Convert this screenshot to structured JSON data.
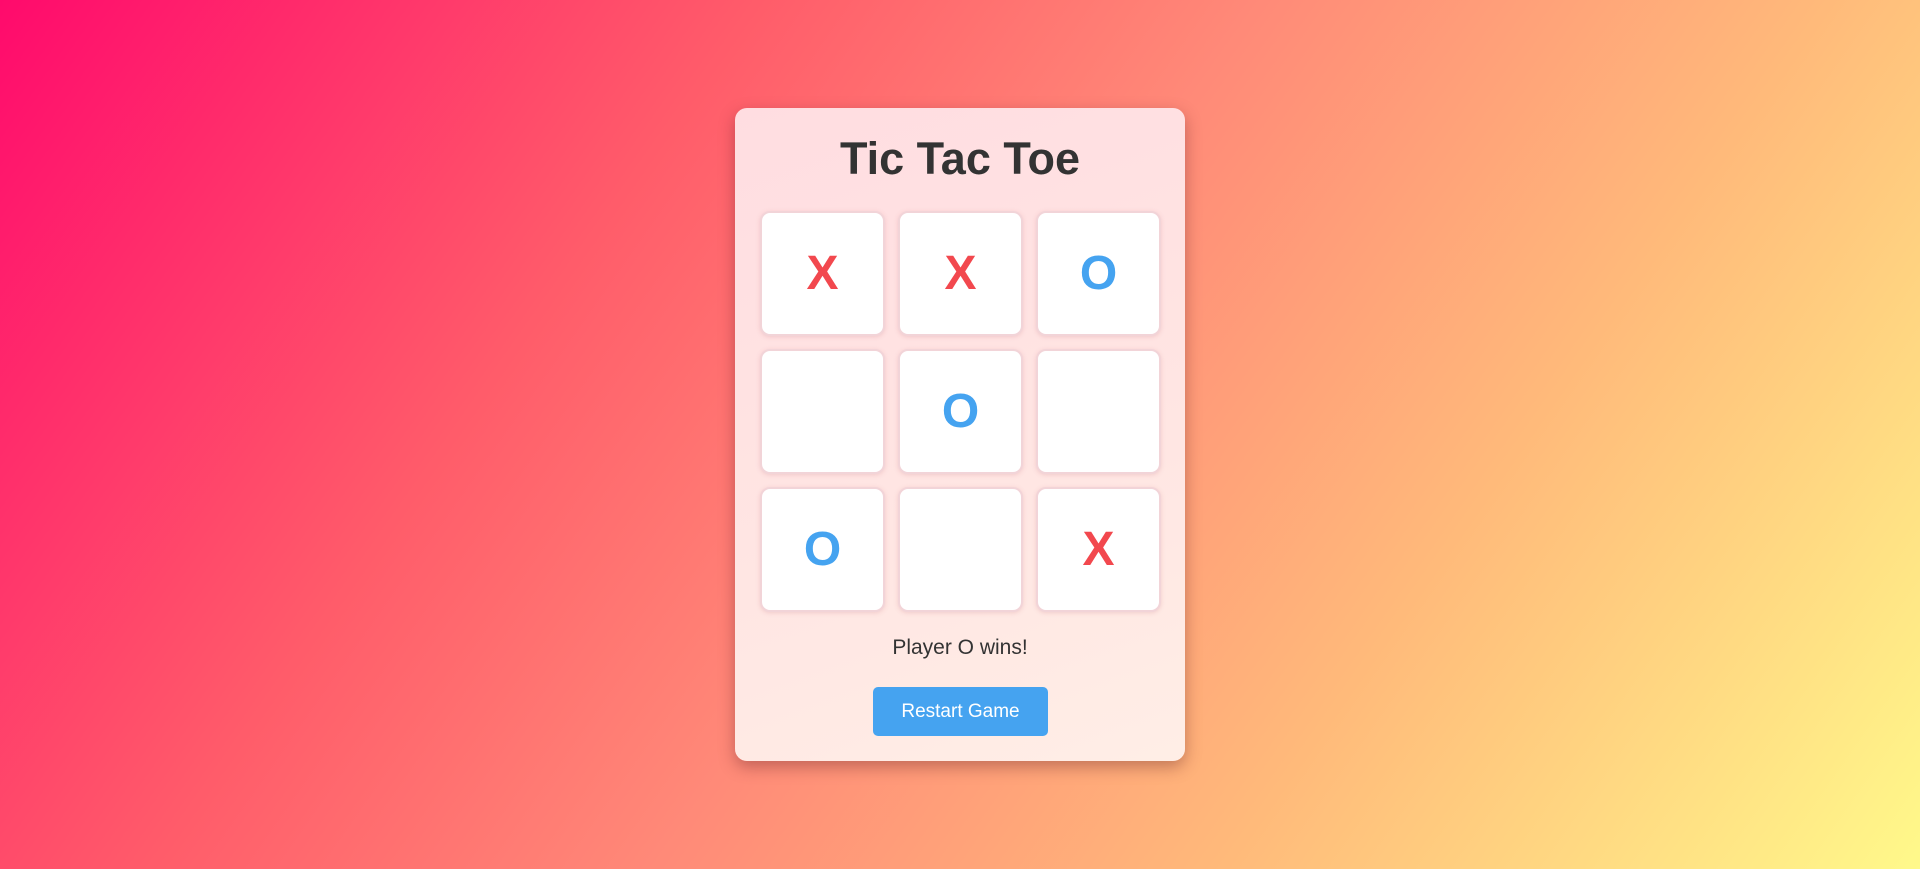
{
  "game": {
    "title": "Tic Tac Toe",
    "board": [
      "X",
      "X",
      "O",
      "",
      "O",
      "",
      "O",
      "",
      "X"
    ],
    "status": "Player O wins!",
    "restart_label": "Restart Game"
  },
  "colors": {
    "x_mark": "#f2484e",
    "o_mark": "#45a3f0",
    "button": "#45a3f0"
  }
}
